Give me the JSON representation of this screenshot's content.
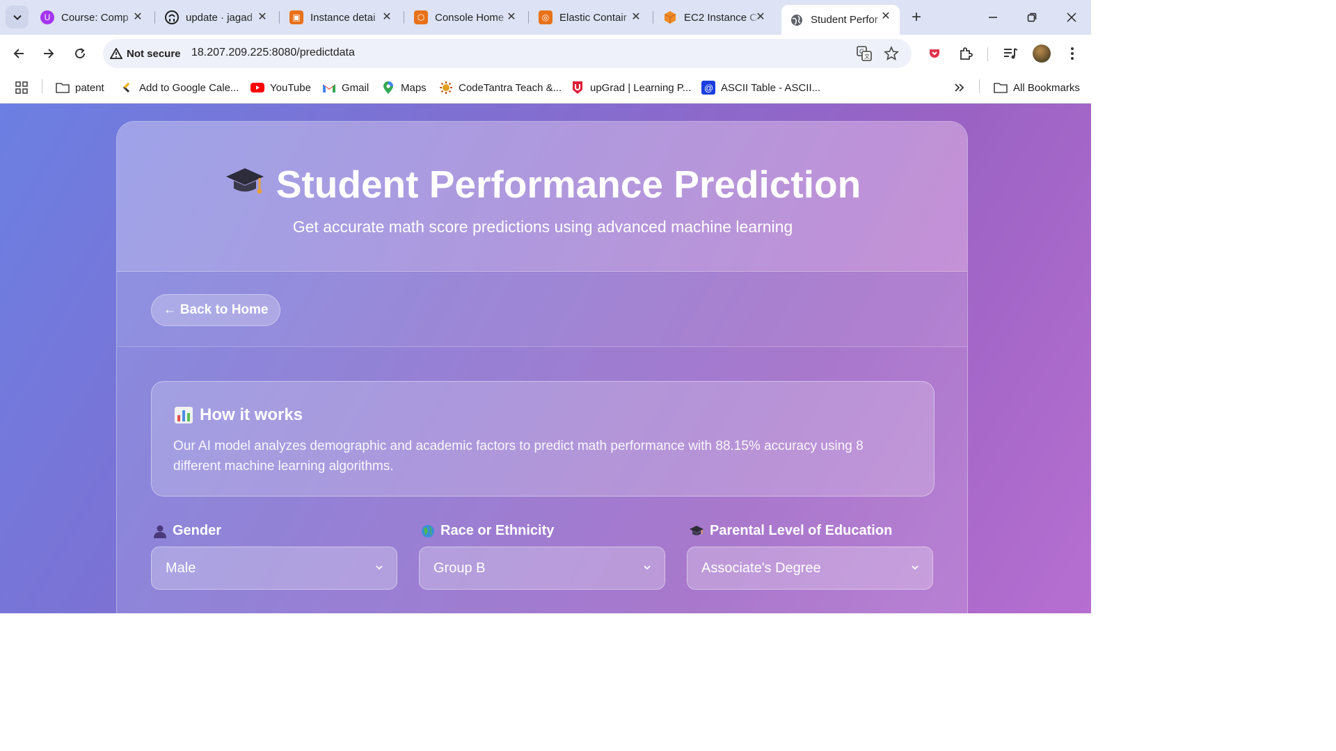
{
  "tabs": [
    {
      "title": "Course: Comp",
      "icon": "udemy-icon"
    },
    {
      "title": "update · jagad",
      "icon": "github-icon"
    },
    {
      "title": "Instance detai",
      "icon": "aws-ec2-icon"
    },
    {
      "title": "Console Home",
      "icon": "aws-console-icon"
    },
    {
      "title": "Elastic Contair",
      "icon": "aws-ecr-icon"
    },
    {
      "title": "EC2 Instance C",
      "icon": "aws-cube-icon"
    },
    {
      "title": "Student Perfor",
      "icon": "globe-icon",
      "active": true
    }
  ],
  "address": {
    "security_label": "Not secure",
    "url": "18.207.209.225:8080/predictdata"
  },
  "bookmarks": [
    {
      "label": "patent",
      "icon": "folder-icon"
    },
    {
      "label": "Add to Google Cale...",
      "icon": "calendar-icon"
    },
    {
      "label": "YouTube",
      "icon": "youtube-icon"
    },
    {
      "label": "Gmail",
      "icon": "gmail-icon"
    },
    {
      "label": "Maps",
      "icon": "maps-icon"
    },
    {
      "label": "CodeTantra Teach &...",
      "icon": "codetantra-icon"
    },
    {
      "label": "upGrad | Learning P...",
      "icon": "upgrad-icon"
    },
    {
      "label": "ASCII Table - ASCII...",
      "icon": "ascii-icon"
    }
  ],
  "all_bookmarks_label": "All Bookmarks",
  "hero": {
    "title": "Student Performance Prediction",
    "subtitle": "Get accurate math score predictions using advanced machine learning"
  },
  "back_button_label": "← Back to Home",
  "info": {
    "title": "How it works",
    "text": "Our AI model analyzes demographic and academic factors to predict math performance with 88.15% accuracy using 8 different machine learning algorithms."
  },
  "fields": [
    {
      "label": "Gender",
      "value": "Male",
      "icon": "person-icon"
    },
    {
      "label": "Race or Ethnicity",
      "value": "Group B",
      "icon": "globe-icon"
    },
    {
      "label": "Parental Level of Education",
      "value": "Associate's Degree",
      "icon": "graduation-cap-icon"
    }
  ]
}
